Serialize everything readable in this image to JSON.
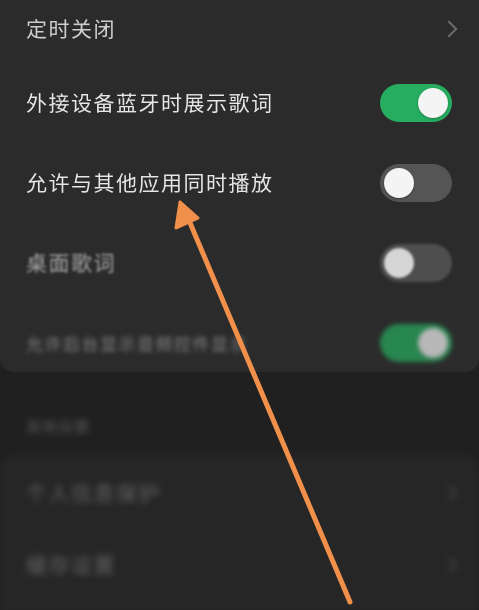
{
  "settings": {
    "timer_close": {
      "label": "定时关闭"
    },
    "bluetooth_lyrics": {
      "label": "外接设备蓝牙时展示歌词",
      "enabled": true
    },
    "simultaneous_play": {
      "label": "允许与其他应用同时播放",
      "enabled": false
    },
    "desktop_lyrics": {
      "label": "桌面歌词",
      "enabled": false
    },
    "allow_background": {
      "label": "允许后台显示音频控件显示",
      "enabled": true
    }
  },
  "section2": {
    "title": "其他设置",
    "items": [
      {
        "label": "个人信息保护"
      },
      {
        "label": "缓存设置"
      }
    ]
  },
  "colors": {
    "toggle_on": "#27ad5f",
    "toggle_off": "#555555",
    "arrow": "#f0904a",
    "background": "#202020"
  },
  "icons": {
    "chevron": "chevron-right-icon",
    "annotation": "arrow-icon"
  }
}
